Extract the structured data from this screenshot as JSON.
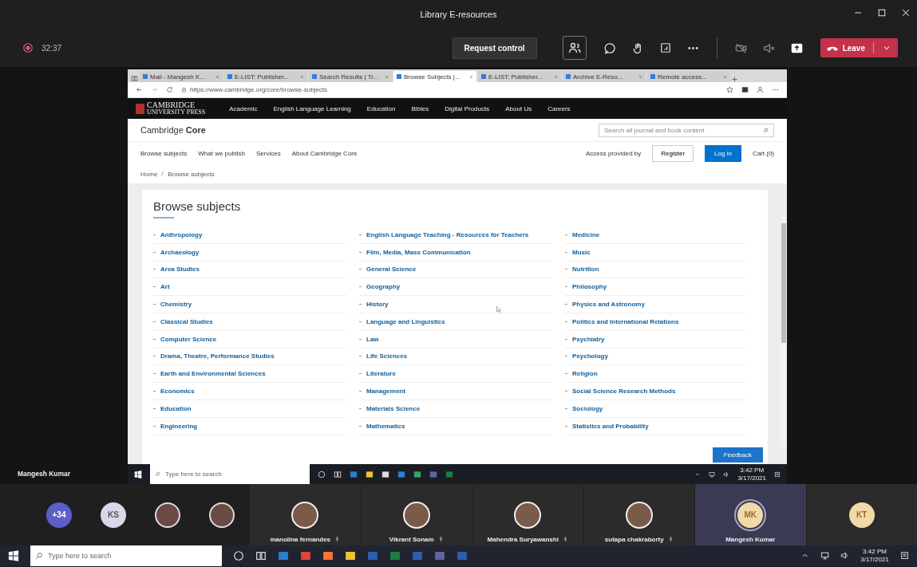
{
  "meeting": {
    "title": "Library E-resources",
    "timer": "32:37",
    "request_control": "Request control",
    "leave": "Leave"
  },
  "shared_screen": {
    "browser": {
      "tabs": [
        {
          "label": "Mail - Mangesh K...",
          "selected": false
        },
        {
          "label": "E-LIST: Publisher...",
          "selected": false
        },
        {
          "label": "Search Results | Tr...",
          "selected": false
        },
        {
          "label": "Browse Subjects |...",
          "selected": true
        },
        {
          "label": "E-LIST: Publisher...",
          "selected": false
        },
        {
          "label": "Archive E-Reso...",
          "selected": false
        },
        {
          "label": "Remote access...",
          "selected": false
        }
      ],
      "url": "https://www.cambridge.org/core/browse-subjects"
    },
    "site": {
      "logo": "CAMBRIDGE",
      "logo_sub": "UNIVERSITY PRESS",
      "nav": [
        "Academic",
        "English Language Learning",
        "Education",
        "Bibles",
        "Digital Products",
        "About Us",
        "Careers"
      ],
      "brand": "Cambridge **Core**",
      "search_placeholder": "Search all journal and book content",
      "subnav": [
        "Browse subjects",
        "What we publish",
        "Services",
        "About Cambridge Core"
      ],
      "access": "Access provided by",
      "register": "Register",
      "login": "Log in",
      "cart": "Cart (0)",
      "breadcrumb": [
        "Home",
        "Browse subjects"
      ],
      "heading": "Browse subjects",
      "subject_columns": [
        [
          "Anthropology",
          "Archaeology",
          "Area Studies",
          "Art",
          "Chemistry",
          "Classical Studies",
          "Computer Science",
          "Drama, Theatre, Performance Studies",
          "Earth and Environmental Sciences",
          "Economics",
          "Education",
          "Engineering"
        ],
        [
          "English Language Teaching - Resources for Teachers",
          "Film, Media, Mass Communication",
          "General Science",
          "Geography",
          "History",
          "Language and Linguistics",
          "Law",
          "Life Sciences",
          "Literature",
          "Management",
          "Materials Science",
          "Mathematics"
        ],
        [
          "Medicine",
          "Music",
          "Nutrition",
          "Philosophy",
          "Physics and Astronomy",
          "Politics and International Relations",
          "Psychiatry",
          "Psychology",
          "Religion",
          "Social Science Research Methods",
          "Sociology",
          "Statistics and Probability"
        ]
      ],
      "feedback": "Feedback"
    },
    "taskbar": {
      "search_placeholder": "Type here to search",
      "time": "3:42 PM",
      "date": "3/17/2021"
    }
  },
  "presenter_label": "Mangesh Kumar",
  "participants": [
    {
      "kind": "count",
      "label": "+34"
    },
    {
      "kind": "initials",
      "label": "KS"
    },
    {
      "kind": "photo"
    },
    {
      "kind": "photo"
    },
    {
      "kind": "tile",
      "name": "manolina fernandes"
    },
    {
      "kind": "tile",
      "name": "Vikrant Sonam"
    },
    {
      "kind": "tile",
      "name": "Mahendra Suryawanshi"
    },
    {
      "kind": "tile",
      "name": "sutapa chakraborty"
    },
    {
      "kind": "tile-initials",
      "label": "MK",
      "name": "Mangesh Kumar"
    },
    {
      "kind": "tile-initials",
      "label": "KT"
    }
  ],
  "taskbar": {
    "search_placeholder": "Type here to search",
    "time": "3:42 PM",
    "date": "3/17/2021"
  }
}
